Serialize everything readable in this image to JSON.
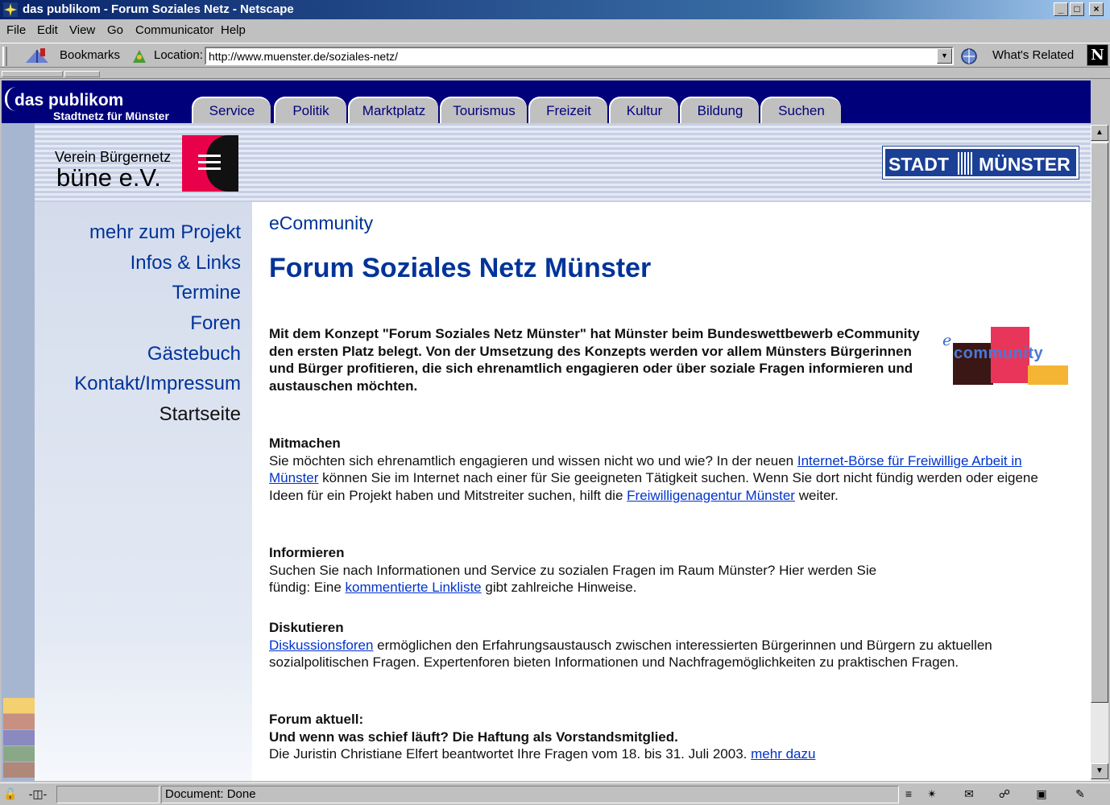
{
  "window": {
    "title": "das publikom - Forum Soziales Netz - Netscape",
    "buttons": [
      "minimize-button",
      "maximize-button",
      "close-button"
    ]
  },
  "menu": [
    "File",
    "Edit",
    "View",
    "Go",
    "Communicator",
    "Help"
  ],
  "toolbar": {
    "bookmarks_label": "Bookmarks",
    "location_label": "Location:",
    "url": "http://www.muenster.de/soziales-netz/",
    "related_label": "What's Related",
    "netscape_logo": "N"
  },
  "site": {
    "logo_main": "das publikom",
    "logo_sub": "Stadtnetz für Münster",
    "nav_tabs": [
      "Service",
      "Politik",
      "Marktplatz",
      "Tourismus",
      "Freizeit",
      "Kultur",
      "Bildung",
      "Suchen"
    ],
    "verein_line1": "Verein Bürgernetz",
    "verein_line2": "büne e.V.",
    "stadt_left": "STADT",
    "stadt_right": "MÜNSTER"
  },
  "sidebar": {
    "items": [
      "mehr zum Projekt",
      "Infos & Links",
      "Termine",
      "Foren",
      "Gästebuch",
      "Kontakt/Impressum",
      "Startseite"
    ]
  },
  "main": {
    "subtitle": "eCommunity",
    "title": "Forum Soziales Netz Münster",
    "intro": "Mit dem Konzept \"Forum Soziales Netz Münster\" hat Münster beim Bundeswettbewerb eCommunity den ersten Platz belegt. Von der Umsetzung des Konzepts werden vor allem Münsters Bürgerinnen und Bürger profitieren, die sich ehrenamtlich engagieren oder über soziale Fragen informieren und austauschen möchten.",
    "ecommunity_logo_e": "e",
    "ecommunity_logo_text": "community",
    "sections": {
      "mitmachen": {
        "heading": "Mitmachen",
        "text1": "Sie möchten sich ehrenamtlich engagieren und wissen nicht wo und wie? In der neuen ",
        "link1": "Internet-Börse für Freiwillige Arbeit in Münster",
        "text2": " können Sie im Internet nach einer für Sie geeigneten Tätigkeit suchen. Wenn Sie dort nicht fündig werden oder eigene Ideen für ein Projekt haben und Mitstreiter suchen, hilft die ",
        "link2": "Freiwilligenagentur Münster",
        "text3": " weiter."
      },
      "informieren": {
        "heading": "Informieren",
        "text1": "Suchen Sie nach Informationen und Service zu sozialen Fragen im Raum Münster? Hier werden Sie fündig: Eine ",
        "link1": "kommentierte Linkliste",
        "text2": " gibt zahlreiche Hinweise."
      },
      "diskutieren": {
        "heading": "Diskutieren",
        "link1": "Diskussionsforen",
        "text1": " ermöglichen den Erfahrungsaustausch zwischen interessierten Bürgerinnen und Bürgern zu aktuellen sozialpolitischen Fragen. Expertenforen bieten Informationen und Nachfragemöglichkeiten zu praktischen Fragen."
      },
      "aktuell": {
        "heading": "Forum aktuell:",
        "subheading": "Und wenn was schief läuft? Die Haftung als Vorstandsmitglied.",
        "text1": "Die Juristin Christiane Elfert beantwortet Ihre Fragen vom 18. bis 31. Juli 2003. ",
        "link1": "mehr dazu"
      }
    }
  },
  "status": {
    "text": "Document: Done"
  },
  "colors": {
    "site_header": "#00007b",
    "link": "#0033cc",
    "nav_text": "#003399"
  }
}
